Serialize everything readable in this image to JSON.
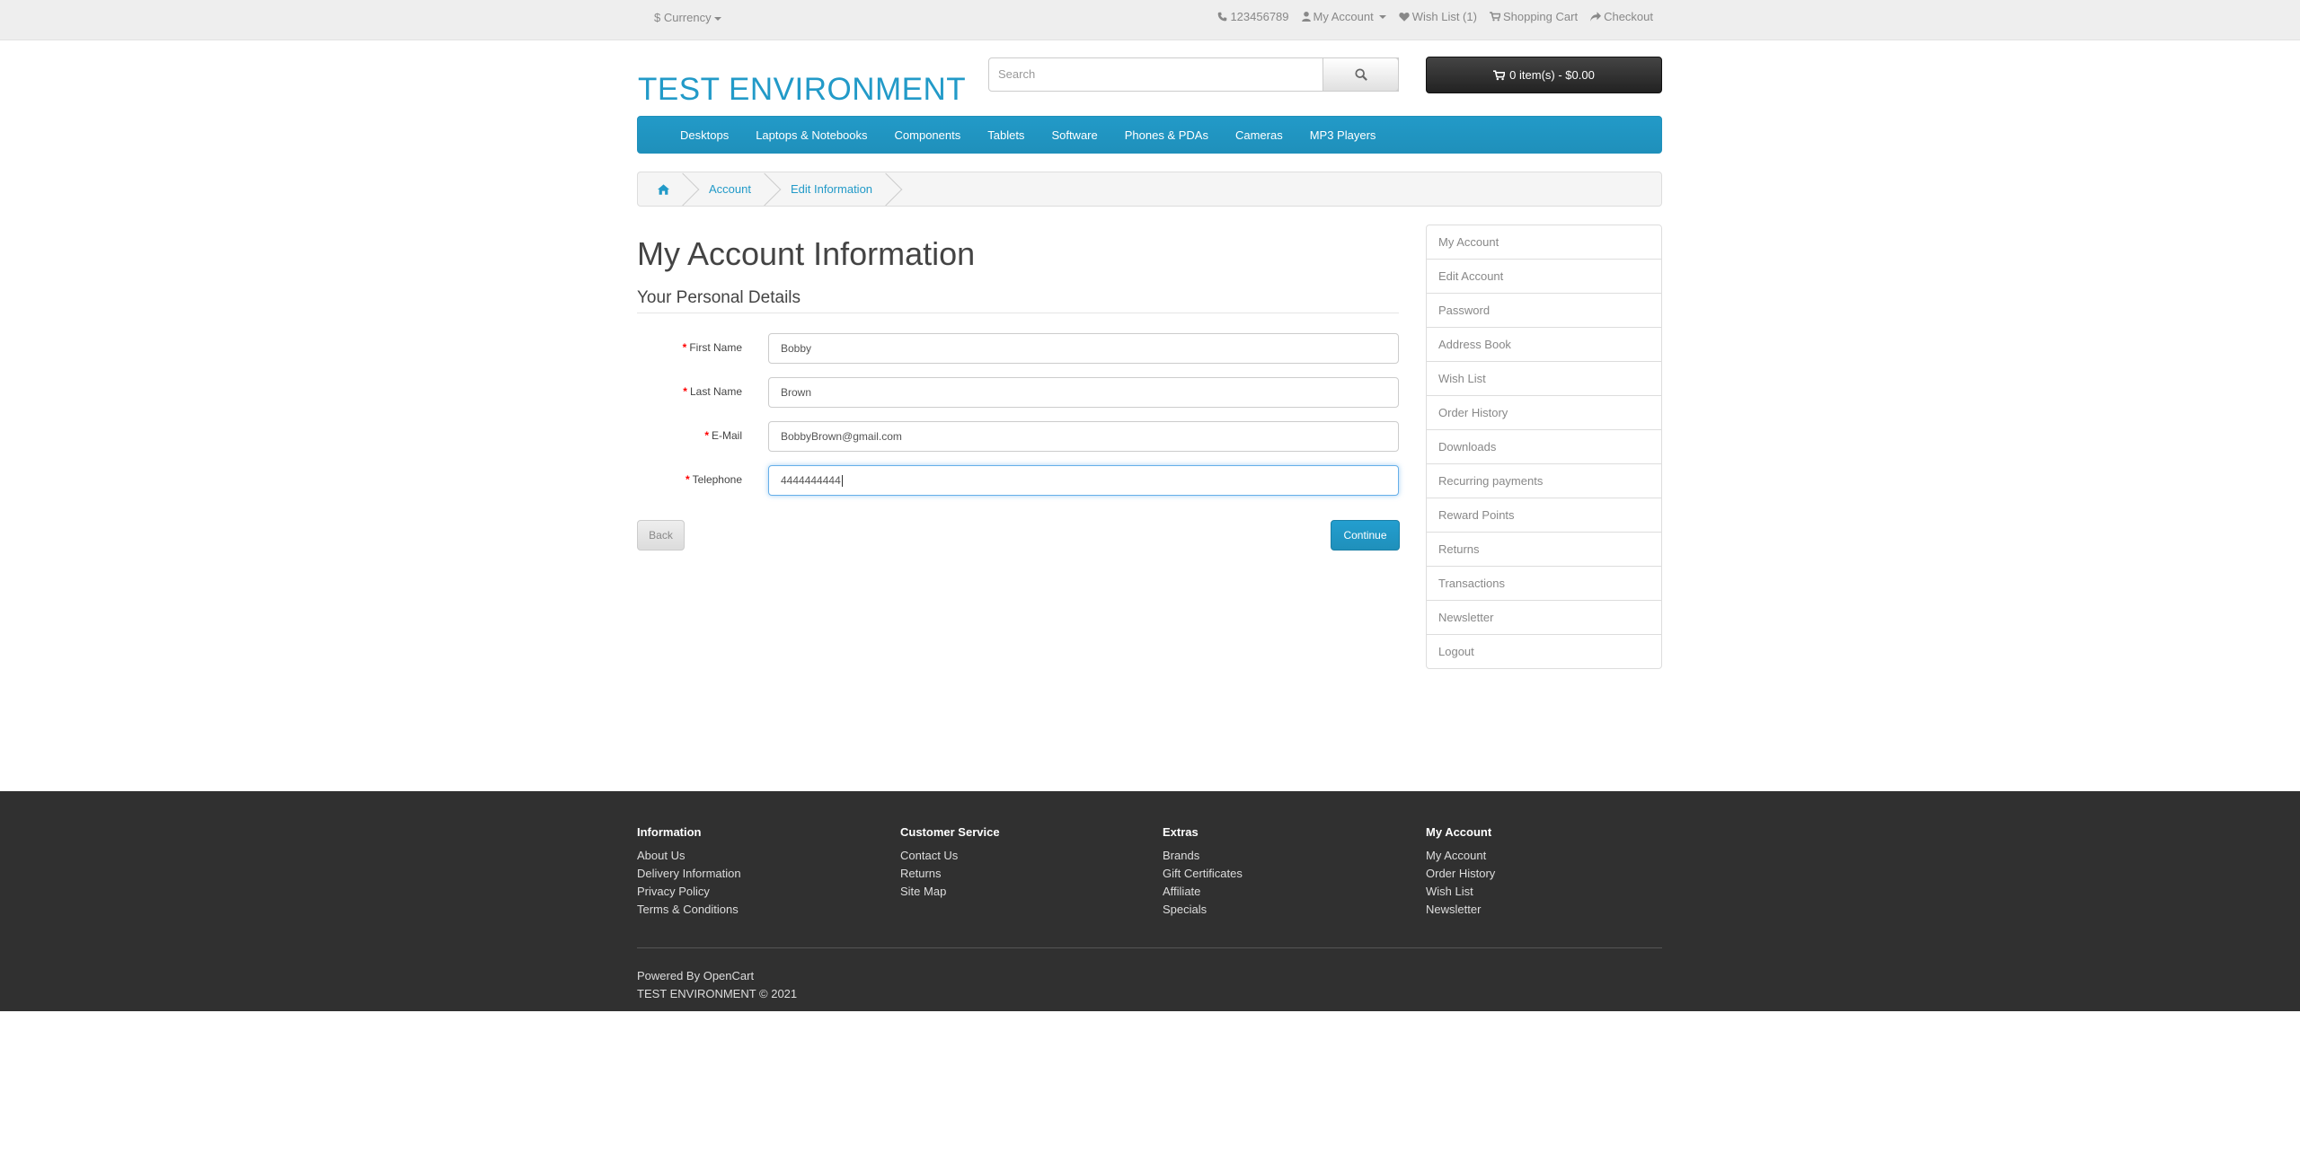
{
  "topbar": {
    "currency_label": "$ Currency",
    "phone": "123456789",
    "my_account": "My Account",
    "wish_list": "Wish List (1)",
    "shopping_cart": "Shopping Cart",
    "checkout": "Checkout"
  },
  "header": {
    "logo": "TEST ENVIRONMENT",
    "search_placeholder": "Search",
    "cart_label": "0 item(s) - $0.00"
  },
  "menu": {
    "items": [
      "Desktops",
      "Laptops & Notebooks",
      "Components",
      "Tablets",
      "Software",
      "Phones & PDAs",
      "Cameras",
      "MP3 Players"
    ]
  },
  "breadcrumb": {
    "items": [
      "Account",
      "Edit Information"
    ]
  },
  "main": {
    "title": "My Account Information",
    "subtitle": "Your Personal Details",
    "fields": [
      {
        "label": "First Name",
        "value": "Bobby"
      },
      {
        "label": "Last Name",
        "value": "Brown"
      },
      {
        "label": "E-Mail",
        "value": "BobbyBrown@gmail.com"
      },
      {
        "label": "Telephone",
        "value": "4444444444"
      }
    ],
    "back_label": "Back",
    "continue_label": "Continue"
  },
  "sidebar": {
    "items": [
      "My Account",
      "Edit Account",
      "Password",
      "Address Book",
      "Wish List",
      "Order History",
      "Downloads",
      "Recurring payments",
      "Reward Points",
      "Returns",
      "Transactions",
      "Newsletter",
      "Logout"
    ]
  },
  "footer": {
    "columns": [
      {
        "title": "Information",
        "links": [
          "About Us",
          "Delivery Information",
          "Privacy Policy",
          "Terms & Conditions"
        ]
      },
      {
        "title": "Customer Service",
        "links": [
          "Contact Us",
          "Returns",
          "Site Map"
        ]
      },
      {
        "title": "Extras",
        "links": [
          "Brands",
          "Gift Certificates",
          "Affiliate",
          "Specials"
        ]
      },
      {
        "title": "My Account",
        "links": [
          "My Account",
          "Order History",
          "Wish List",
          "Newsletter"
        ]
      }
    ],
    "powered_prefix": "Powered By",
    "powered_link": "OpenCart",
    "copyright": "TEST ENVIRONMENT © 2021"
  },
  "colors": {
    "brand": "#229ac8",
    "footer_bg": "#303030",
    "required": "#ff0000"
  }
}
